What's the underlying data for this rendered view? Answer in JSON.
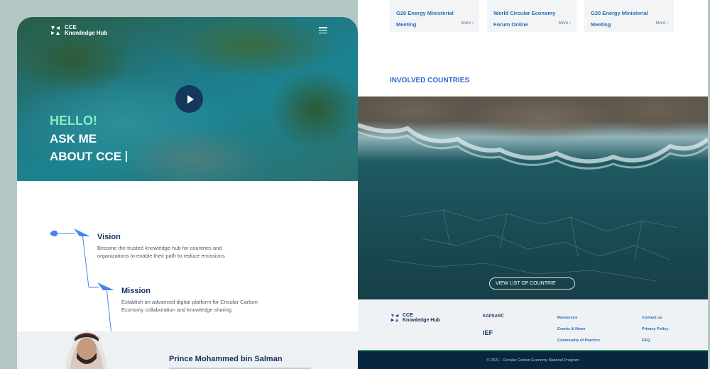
{
  "left_panel": {
    "logo": {
      "line1": "CCE",
      "line2": "Knowledge Hub"
    },
    "hero": {
      "hello": "HELLO!",
      "ask": "ASK ME",
      "about": "ABOUT CCE"
    },
    "vision": {
      "title": "Vision",
      "desc": "Become the trusted knowledge hub for countries and organizations to enable their path to reduce emissions"
    },
    "mission": {
      "title": "Mission",
      "desc": "Establish an advanced digital platform for Circular Carbon Economy collaboration and knowledge sharing"
    },
    "person": {
      "name": "Prince Mohammed bin Salman"
    }
  },
  "right_panel": {
    "events": [
      {
        "title": "G20  Energy Ministerial Meeting",
        "more": "More"
      },
      {
        "title": "World Circular Economy Forum Online",
        "more": "More"
      },
      {
        "title": "G20  Energy Ministerial Meeting",
        "more": "More"
      }
    ],
    "countries_title": "INVOLVED COUNTRIES",
    "view_button": "VIEW LIST OF COUNTRIE",
    "footer": {
      "logo": {
        "line1": "CCE",
        "line2": "Knowledge Hub"
      },
      "partners": [
        "KAPSARC",
        "IEF"
      ],
      "links_col1": [
        "Resources",
        "Events & News",
        "Community of Practice"
      ],
      "links_col2": [
        "Contact us",
        "Privacy Policy",
        "FAQ"
      ],
      "copyright": "© 2021 - Circular Carbon Economy National Program"
    }
  },
  "colors": {
    "accent_blue": "#2e6ad0",
    "navy": "#17325c",
    "hello_green": "#86ecc2",
    "footer_bar": "#08273f"
  },
  "icons": [
    "cce-logo-icon",
    "menu-icon",
    "play-icon",
    "chevron-right-icon"
  ]
}
